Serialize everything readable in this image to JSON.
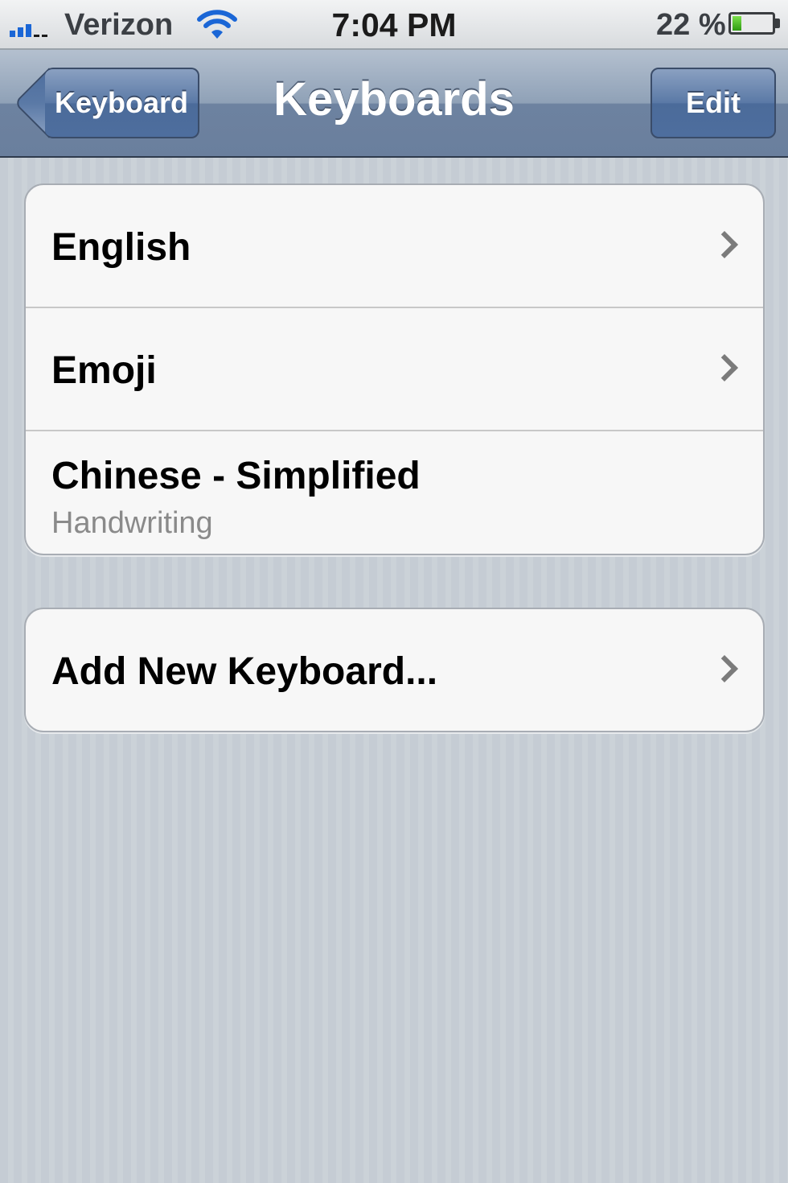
{
  "status_bar": {
    "carrier": "Verizon",
    "time": "7:04 PM",
    "battery_percent": "22 %",
    "battery_level": 0.22,
    "signal_bars_active": 3,
    "icons": [
      "signal-icon",
      "wifi-icon",
      "battery-icon"
    ]
  },
  "nav": {
    "back_label": "Keyboard",
    "title": "Keyboards",
    "edit_label": "Edit"
  },
  "keyboards": [
    {
      "label": "English",
      "has_chevron": true
    },
    {
      "label": "Emoji",
      "has_chevron": true
    },
    {
      "label": "Chinese - Simplified",
      "sublabel": "Handwriting",
      "has_chevron": false
    }
  ],
  "add_keyboard": {
    "label": "Add New Keyboard...",
    "has_chevron": true
  },
  "colors": {
    "nav_bar": "#6d82a0",
    "table_background": "#c5ccd4",
    "cell_background": "#f7f7f7",
    "sublabel": "#8a8a8a",
    "signal_active": "#1a66d6",
    "battery_fill": "#4cb82a"
  }
}
